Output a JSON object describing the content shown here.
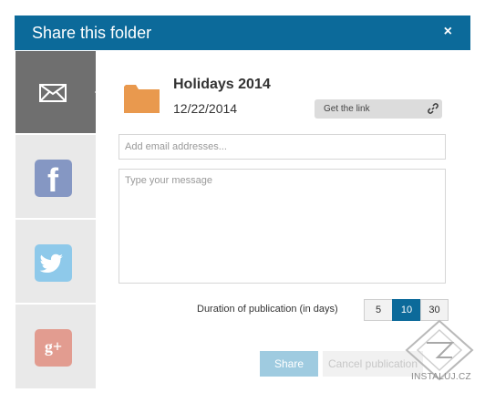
{
  "dialog": {
    "title": "Share this folder",
    "close_label": "×"
  },
  "sidebar": {
    "items": [
      {
        "name": "Email",
        "icon": "mail-icon"
      },
      {
        "name": "Facebook",
        "icon": "facebook-icon",
        "glyph": "f"
      },
      {
        "name": "Twitter",
        "icon": "twitter-icon"
      },
      {
        "name": "Google+",
        "icon": "google-plus-icon",
        "glyph": "g+"
      }
    ]
  },
  "folder": {
    "name": "Holidays 2014",
    "date": "12/22/2014",
    "get_link_label": "Get the link",
    "icon": "folder-icon",
    "color": "#e9994e"
  },
  "form": {
    "email_placeholder": "Add email addresses...",
    "message_placeholder": "Type your message",
    "duration_label": "Duration of publication (in days)",
    "duration_options": [
      "5",
      "10",
      "30"
    ],
    "duration_selected": "10",
    "share_label": "Share",
    "cancel_label": "Cancel publication"
  },
  "watermark": {
    "text": "INSTALUJ.CZ"
  },
  "colors": {
    "accent": "#0c6a9a",
    "share_button": "#9fcbe0"
  }
}
